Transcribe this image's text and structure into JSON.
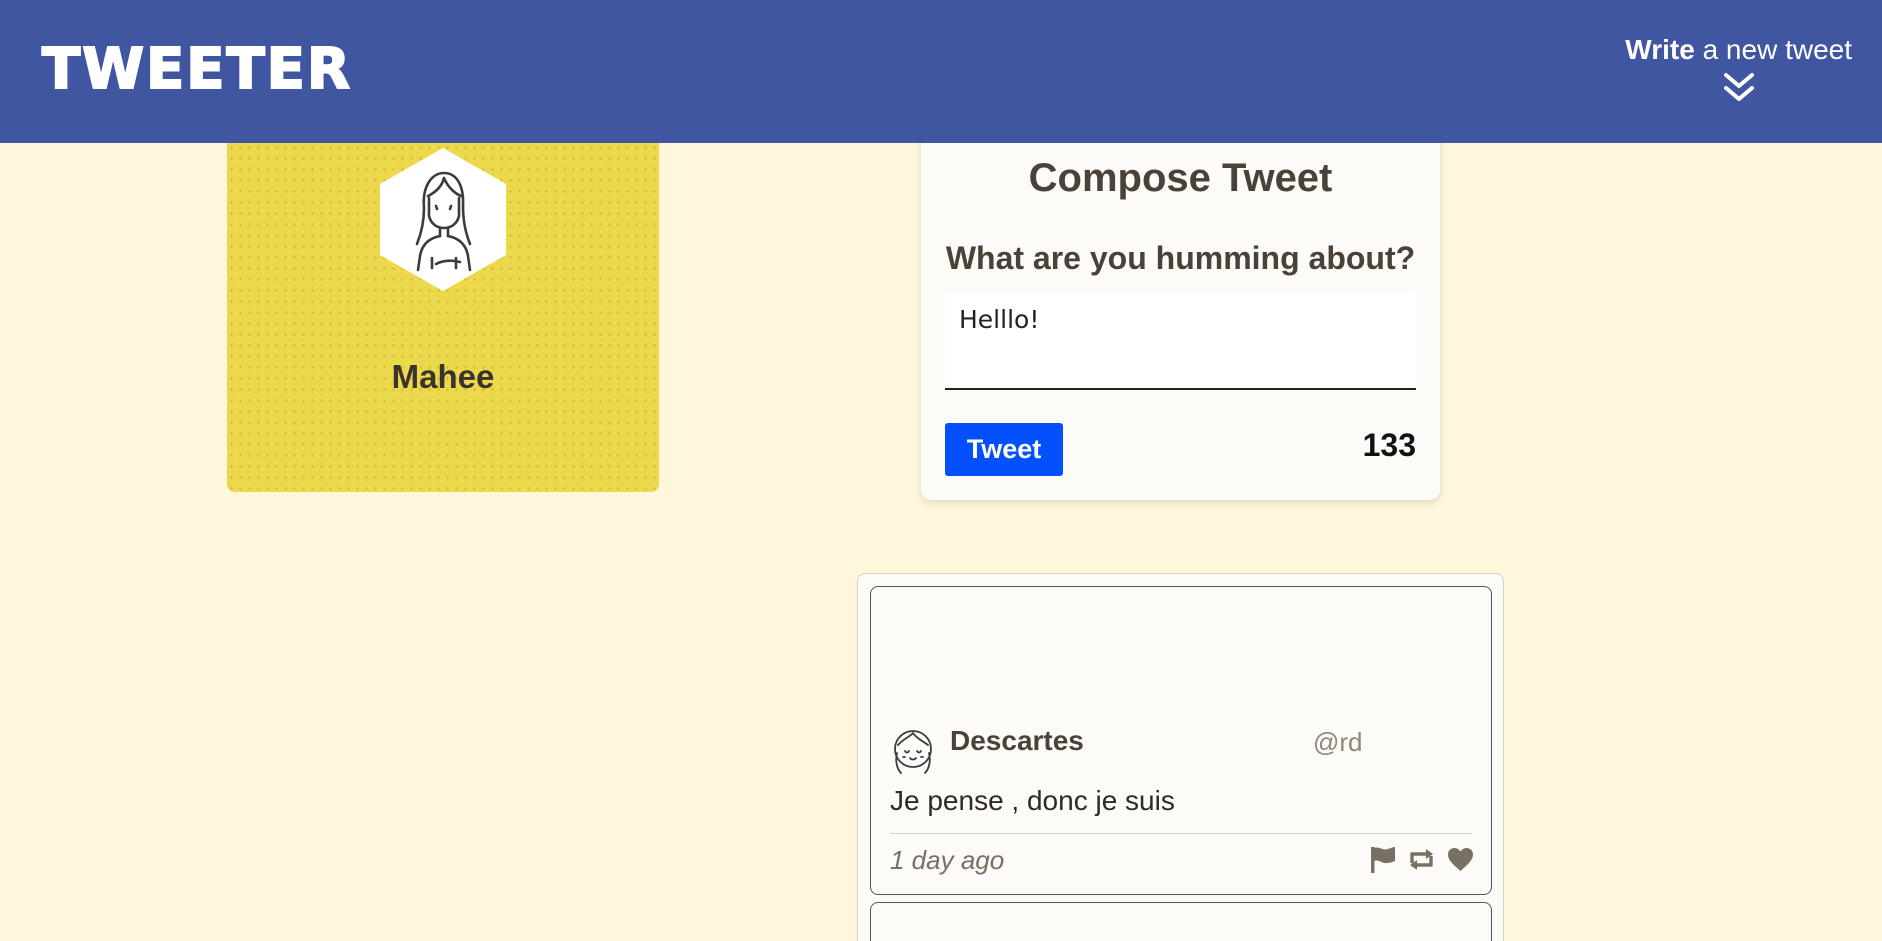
{
  "header": {
    "logo": "TWEETER",
    "write_bold": "Write",
    "write_rest": " a new tweet"
  },
  "profile": {
    "name": "Mahee"
  },
  "compose": {
    "title": "Compose Tweet",
    "prompt": "What are you humming about?",
    "textarea_value": "Helllo!",
    "tweet_button": "Tweet",
    "char_count": "133"
  },
  "tweets": [
    {
      "name": "Descartes",
      "handle": "@rd",
      "text": "Je pense , donc je suis",
      "time": "1 day ago",
      "actions": [
        "flag-icon",
        "retweet-icon",
        "heart-icon"
      ]
    }
  ],
  "colors": {
    "nav": "#4056a1",
    "page_bg": "#fff7db",
    "profile_bg": "#ecd84a",
    "tweet_button": "#0450fc"
  }
}
